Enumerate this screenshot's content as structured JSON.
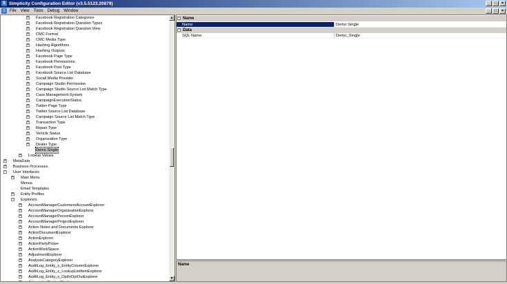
{
  "window": {
    "title": "Simplicity Configuration Editor (v3.5.5123.20879)"
  },
  "menu": {
    "items": [
      "File",
      "View",
      "Tools",
      "Debug",
      "Window"
    ]
  },
  "window_buttons": {
    "minimize": "_",
    "maximize": "□",
    "close": "×"
  },
  "tree": {
    "rows": [
      {
        "label": "Facebook Registration Categories",
        "level": 4,
        "exp": "+"
      },
      {
        "label": "Facebook Registration Question Types",
        "level": 4,
        "exp": "+"
      },
      {
        "label": "Facebook Registration Question View",
        "level": 4,
        "exp": "+"
      },
      {
        "label": "CMC Format",
        "level": 4,
        "exp": "+"
      },
      {
        "label": "CMC Media Type",
        "level": 4,
        "exp": "+"
      },
      {
        "label": "Hashing Algorithms",
        "level": 4,
        "exp": "+"
      },
      {
        "label": "Hashing Outputs",
        "level": 4,
        "exp": "+"
      },
      {
        "label": "Facebook Page Type",
        "level": 4,
        "exp": "+"
      },
      {
        "label": "Facebook Permissions",
        "level": 4,
        "exp": "+"
      },
      {
        "label": "Facebook Post Type",
        "level": 4,
        "exp": "+"
      },
      {
        "label": "Facebook Source List Database",
        "level": 4,
        "exp": "+"
      },
      {
        "label": "Social Media Provider",
        "level": 4,
        "exp": "+"
      },
      {
        "label": "Campaign Studio Permission",
        "level": 4,
        "exp": "+"
      },
      {
        "label": "Campaign Studio Source List Match Type",
        "level": 4,
        "exp": "+"
      },
      {
        "label": "Case Management System",
        "level": 4,
        "exp": "+"
      },
      {
        "label": "CampaignExecutionStatus",
        "level": 4,
        "exp": "+"
      },
      {
        "label": "Twitter Page Type",
        "level": 4,
        "exp": "+"
      },
      {
        "label": "Twitter Source List Database",
        "level": 4,
        "exp": "+"
      },
      {
        "label": "Campaign Source List Match Type",
        "level": 4,
        "exp": "+"
      },
      {
        "label": "Transaction Type",
        "level": 4,
        "exp": "+"
      },
      {
        "label": "Repair Type",
        "level": 4,
        "exp": "+"
      },
      {
        "label": "Vehicle Status",
        "level": 4,
        "exp": "+"
      },
      {
        "label": "Organisation Type",
        "level": 4,
        "exp": "+"
      },
      {
        "label": "Dealer Type",
        "level": 4,
        "exp": "+"
      },
      {
        "label": "Demo Single",
        "level": 4,
        "exp": "",
        "selected": true
      },
      {
        "label": "Lookup Values",
        "level": 3,
        "exp": "+"
      },
      {
        "label": "MetaData",
        "level": 1,
        "exp": "+"
      },
      {
        "label": "Business Processes",
        "level": 1,
        "exp": "+"
      },
      {
        "label": "User Interfaces",
        "level": 1,
        "exp": "-"
      },
      {
        "label": "Main Menu",
        "level": 2,
        "exp": "+"
      },
      {
        "label": "Menus",
        "level": 2,
        "exp": ""
      },
      {
        "label": "Email Templates",
        "level": 2,
        "exp": ""
      },
      {
        "label": "Entity Profiles",
        "level": 2,
        "exp": "+"
      },
      {
        "label": "Explorers",
        "level": 2,
        "exp": "-"
      },
      {
        "label": "AccountManagerCustomersAccountExplorer",
        "level": 3,
        "exp": "+"
      },
      {
        "label": "AccountManagerOrganisationExplorer",
        "level": 3,
        "exp": "+"
      },
      {
        "label": "AccountManagerPersonExplorer",
        "level": 3,
        "exp": "+"
      },
      {
        "label": "AccountManagerProjectExplorer",
        "level": 3,
        "exp": "+"
      },
      {
        "label": "Action Notes and Documents Explorer",
        "level": 3,
        "exp": "+"
      },
      {
        "label": "ActionDocumentExplorer",
        "level": 3,
        "exp": "+"
      },
      {
        "label": "ActionExplorer",
        "level": 3,
        "exp": "+"
      },
      {
        "label": "ActionPartyPicker",
        "level": 3,
        "exp": "+"
      },
      {
        "label": "ActionWorkSpace",
        "level": 3,
        "exp": "+"
      },
      {
        "label": "AdjustmentExplorer",
        "level": 3,
        "exp": "+"
      },
      {
        "label": "AnalysisCategoryExplorer",
        "level": 3,
        "exp": "+"
      },
      {
        "label": "AuditLog_Entity_x_EntityColumnExplorer",
        "level": 3,
        "exp": "+"
      },
      {
        "label": "AuditLog_Entity_x_LookupListItemExplorer",
        "level": 3,
        "exp": "+"
      },
      {
        "label": "AuditLog_Entity_x_OptInOptOutExplorer",
        "level": 3,
        "exp": "+"
      },
      {
        "label": "AutomotiveProductExplorer",
        "level": 3,
        "exp": "+"
      }
    ]
  },
  "properties": {
    "categories": [
      {
        "label": "Name",
        "toggle": "-",
        "rows": [
          {
            "name": "Name",
            "value": "Demo Single",
            "selected": true
          }
        ]
      },
      {
        "label": "Data",
        "toggle": "-",
        "rows": [
          {
            "name": "SQL Name",
            "value": "Demo_Single",
            "selected": false
          }
        ]
      }
    ]
  },
  "description": {
    "title": "Name"
  },
  "scrollbar": {
    "up": "▲",
    "down": "▼"
  }
}
